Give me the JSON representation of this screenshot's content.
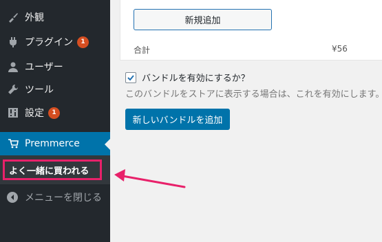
{
  "sidebar": {
    "items": [
      {
        "label": "外観",
        "icon": "brush-icon"
      },
      {
        "label": "プラグイン",
        "icon": "plugin-icon",
        "badge": "1"
      },
      {
        "label": "ユーザー",
        "icon": "user-icon"
      },
      {
        "label": "ツール",
        "icon": "wrench-icon"
      },
      {
        "label": "設定",
        "icon": "settings-icon",
        "badge": "1"
      },
      {
        "label": "Premmerce",
        "icon": "cart-icon"
      }
    ],
    "submenu": {
      "label": "よく一緒に買われる"
    },
    "collapse_label": "メニューを閉じる",
    "active_color": "#0073aa",
    "badge_color": "#d54e21"
  },
  "panel": {
    "add_new_label": "新規追加",
    "total_label": "合計",
    "total_value": "¥56"
  },
  "bundle": {
    "enable_label": "バンドルを有効にするか？",
    "enable_checked": true,
    "helper_text": "このバンドルをストアに表示する場合は、これを有効にします。",
    "add_bundle_label": "新しいバンドルを追加"
  },
  "annotation": {
    "highlight_color": "#e8216a"
  }
}
